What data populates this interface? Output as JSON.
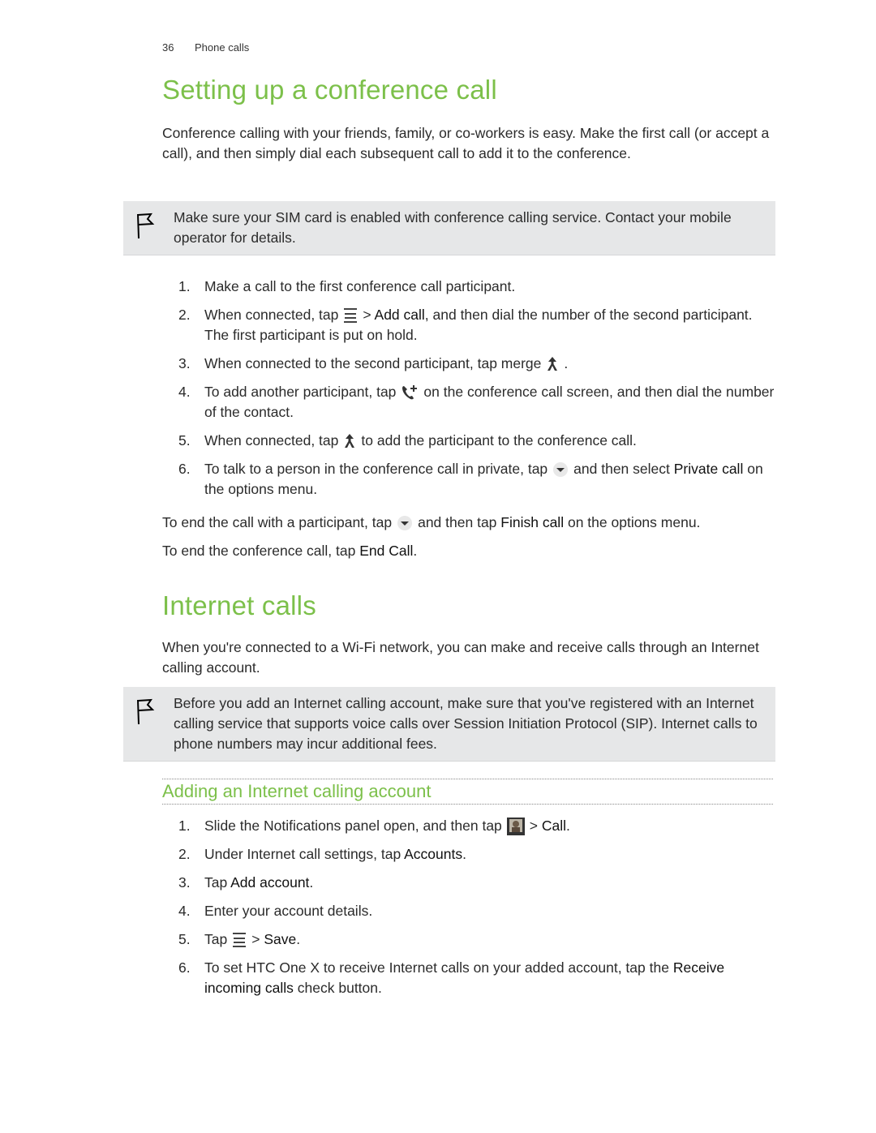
{
  "header": {
    "page_number": "36",
    "section": "Phone calls"
  },
  "section1": {
    "title": "Setting up a conference call",
    "intro": "Conference calling with your friends, family, or co-workers is easy. Make the first call (or accept a call), and then simply dial each subsequent call to add it to the conference.",
    "note": "Make sure your SIM card is enabled with conference calling service. Contact your mobile operator for details.",
    "steps": [
      {
        "n": "1.",
        "text": "Make a call to the first conference call participant."
      },
      {
        "n": "2.",
        "pre": "When connected, tap",
        "icon": "menu-icon",
        "mid": "> ",
        "bold": "Add call",
        "post": ", and then dial the number of the second participant. The first participant is put on hold."
      },
      {
        "n": "3.",
        "pre": "When connected to the second participant, tap merge",
        "icon": "merge-icon",
        "post": "."
      },
      {
        "n": "4.",
        "pre": "To add another participant, tap",
        "icon": "add-call-icon",
        "post": "on the conference call screen, and then dial the number of the contact."
      },
      {
        "n": "5.",
        "pre": "When connected, tap",
        "icon": "merge-icon",
        "post": "to add the participant to the conference call."
      },
      {
        "n": "6.",
        "pre": "To talk to a person in the conference call in private, tap",
        "icon": "dropdown-icon",
        "post": "and then select",
        "bold": "Private call",
        "post2": "on the options menu."
      }
    ],
    "end_participant": {
      "pre": "To end the call with a participant, tap",
      "mid": "and then tap",
      "bold": "Finish call",
      "post": "on the options menu."
    },
    "end_conference": {
      "pre": "To end the conference call, tap",
      "bold": "End Call",
      "post": "."
    }
  },
  "section2": {
    "title": "Internet calls",
    "intro": "When you're connected to a Wi-Fi network, you can make and receive calls through an Internet calling account.",
    "note": "Before you add an Internet calling account, make sure that you've registered with an Internet calling service that supports voice calls over Session Initiation Protocol (SIP). Internet calls to phone numbers may incur additional fees.",
    "subsection_title": "Adding an Internet calling account",
    "steps": [
      {
        "n": "1.",
        "pre": "Slide the Notifications panel open, and then tap",
        "icon": "settings-shortcut-icon",
        "mid": "> ",
        "bold": "Call",
        "post": "."
      },
      {
        "n": "2.",
        "pre": "Under Internet call settings, tap",
        "bold": "Accounts",
        "post": "."
      },
      {
        "n": "3.",
        "pre": "Tap",
        "bold": "Add account",
        "post": "."
      },
      {
        "n": "4.",
        "text": "Enter your account details."
      },
      {
        "n": "5.",
        "pre": "Tap",
        "icon": "menu-icon",
        "mid": "> ",
        "bold": "Save",
        "post": "."
      },
      {
        "n": "6.",
        "pre": "To set HTC One X to receive Internet calls on your added account, tap the",
        "bold": "Receive incoming calls",
        "post": "check button."
      }
    ]
  },
  "colors": {
    "heading": "#7cc04a",
    "note_bg": "#e6e7e8",
    "text": "#2b2b2b"
  }
}
